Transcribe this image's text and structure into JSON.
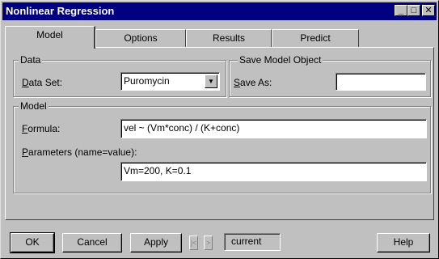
{
  "window": {
    "title": "Nonlinear Regression",
    "controls": {
      "minimize": "_",
      "maximize": "□",
      "close": "✕"
    }
  },
  "tabs": [
    {
      "label": "Model",
      "active": true
    },
    {
      "label": "Options",
      "active": false
    },
    {
      "label": "Results",
      "active": false
    },
    {
      "label": "Predict",
      "active": false
    }
  ],
  "data_group": {
    "legend": "Data",
    "dataset_label_u": "D",
    "dataset_label_rest": "ata Set:",
    "dataset_value": "Puromycin"
  },
  "save_group": {
    "legend": "Save Model Object",
    "saveas_label_u": "S",
    "saveas_label_rest": "ave As:",
    "saveas_value": ""
  },
  "model_group": {
    "legend": "Model",
    "formula_label_u": "F",
    "formula_label_rest": "ormula:",
    "formula_value": "vel ~ (Vm*conc) / (K+conc)",
    "params_label_u": "P",
    "params_label_rest": "arameters (name=value):",
    "params_value": "Vm=200, K=0.1"
  },
  "buttons": {
    "ok": "OK",
    "cancel": "Cancel",
    "apply": "Apply",
    "prev": "|<",
    "next": ">",
    "current": "current",
    "help": "Help"
  },
  "colors": {
    "titlebar": "#000080",
    "face": "#c0c0c0"
  }
}
